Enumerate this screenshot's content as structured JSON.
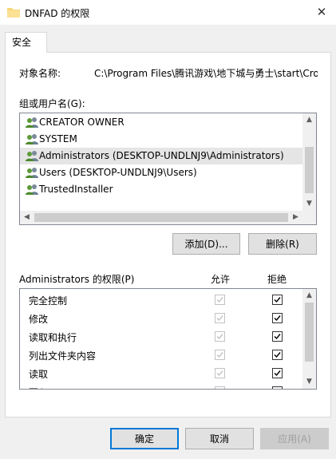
{
  "window": {
    "title": "DNFAD 的权限",
    "close_glyph": "✕"
  },
  "tab": {
    "label": "安全"
  },
  "object_name": {
    "label": "对象名称:",
    "value": "C:\\Program Files\\腾讯游戏\\地下城与勇士\\start\\Cro"
  },
  "groups": {
    "label": "组或用户名(G):",
    "items": [
      {
        "label": "CREATOR OWNER",
        "icon": "user-group-icon",
        "selected": false
      },
      {
        "label": "SYSTEM",
        "icon": "user-group-icon",
        "selected": false
      },
      {
        "label": "Administrators (DESKTOP-UNDLNJ9\\Administrators)",
        "icon": "user-group-icon",
        "selected": true
      },
      {
        "label": "Users (DESKTOP-UNDLNJ9\\Users)",
        "icon": "user-group-icon",
        "selected": false
      },
      {
        "label": "TrustedInstaller",
        "icon": "user-group-icon",
        "selected": false
      }
    ]
  },
  "group_buttons": {
    "add": "添加(D)...",
    "remove": "删除(R)"
  },
  "permissions": {
    "label": "Administrators 的权限(P)",
    "allow_header": "允许",
    "deny_header": "拒绝",
    "rows": [
      {
        "name": "完全控制",
        "allow": true,
        "deny": true
      },
      {
        "name": "修改",
        "allow": true,
        "deny": true
      },
      {
        "name": "读取和执行",
        "allow": true,
        "deny": true
      },
      {
        "name": "列出文件夹内容",
        "allow": true,
        "deny": true
      },
      {
        "name": "读取",
        "allow": true,
        "deny": true
      },
      {
        "name": "写入",
        "allow": true,
        "deny": true
      }
    ]
  },
  "footer": {
    "ok": "确定",
    "cancel": "取消",
    "apply": "应用(A)"
  },
  "colors": {
    "accent": "#0078d7",
    "selection": "#e5e5e5",
    "disabled_check": "#c2c2c2"
  }
}
